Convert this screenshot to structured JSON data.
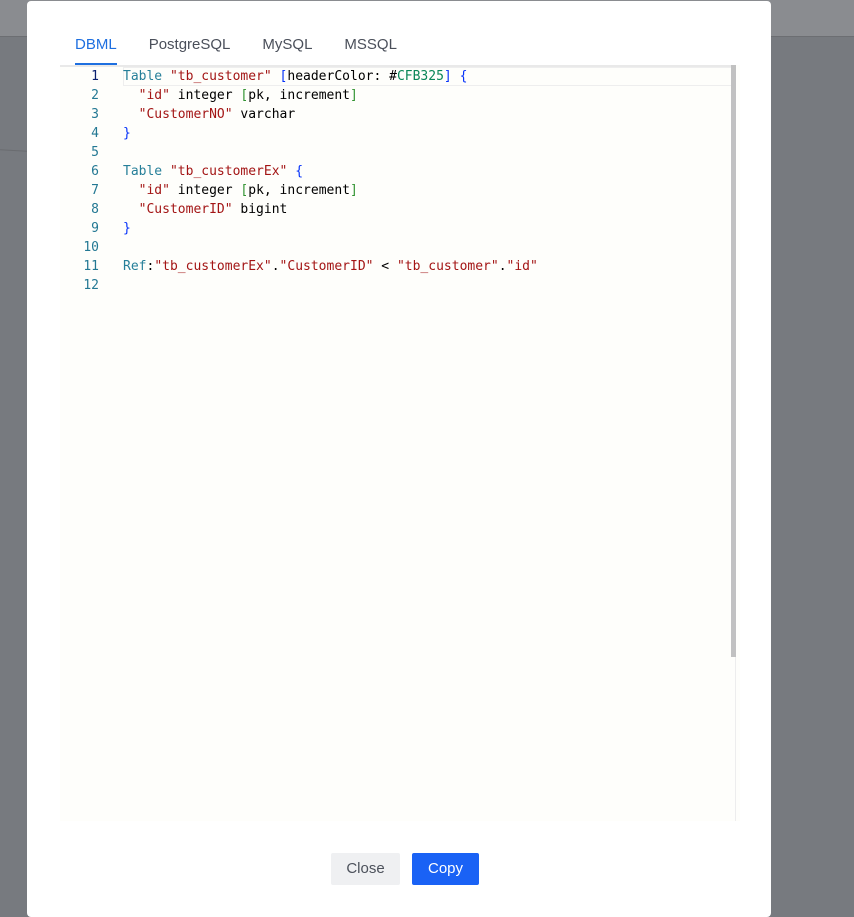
{
  "tabs": [
    {
      "label": "DBML",
      "active": true
    },
    {
      "label": "PostgreSQL",
      "active": false
    },
    {
      "label": "MySQL",
      "active": false
    },
    {
      "label": "MSSQL",
      "active": false
    }
  ],
  "editor": {
    "line_numbers": [
      "1",
      "2",
      "3",
      "4",
      "5",
      "6",
      "7",
      "8",
      "9",
      "10",
      "11",
      "12"
    ],
    "current_line": 1,
    "tokens": {
      "l1_kw": "Table",
      "l1_name": "\"tb_customer\"",
      "l1_open": "[",
      "l1_setting": "headerColor: #",
      "l1_color": "CFB325",
      "l1_close": "]",
      "l1_brace": "{",
      "l2_col": "\"id\"",
      "l2_type": "integer",
      "l2_open": "[",
      "l2_settings": "pk, increment",
      "l2_close": "]",
      "l3_col": "\"CustomerNO\"",
      "l3_type": "varchar",
      "l4_brace": "}",
      "l6_kw": "Table",
      "l6_name": "\"tb_customerEx\"",
      "l6_brace": "{",
      "l7_col": "\"id\"",
      "l7_type": "integer",
      "l7_open": "[",
      "l7_settings": "pk, increment",
      "l7_close": "]",
      "l8_col": "\"CustomerID\"",
      "l8_type": "bigint",
      "l9_brace": "}",
      "l11_kw": "Ref",
      "l11_colon": ":",
      "l11_t1": "\"tb_customerEx\"",
      "l11_dot1": ".",
      "l11_c1": "\"CustomerID\"",
      "l11_op": "<",
      "l11_t2": "\"tb_customer\"",
      "l11_dot2": ".",
      "l11_c2": "\"id\""
    }
  },
  "buttons": {
    "close_label": "Close",
    "copy_label": "Copy"
  },
  "colors": {
    "accent": "#1a62f5",
    "keyword": "#267f99",
    "string": "#a31515",
    "bracket": "#0431fa",
    "line_number": "#237893"
  }
}
